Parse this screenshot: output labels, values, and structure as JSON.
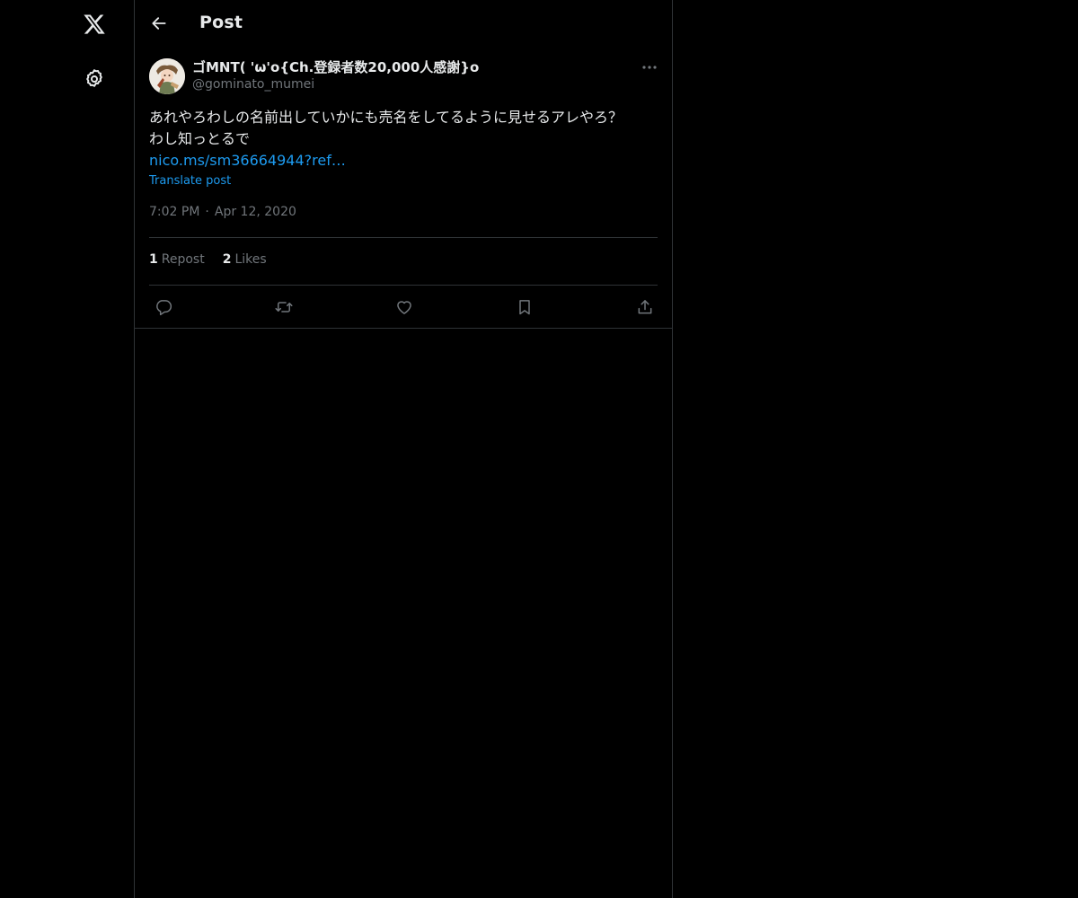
{
  "nav": {
    "logo_icon": "x-logo-icon",
    "settings_icon": "gear-icon"
  },
  "header": {
    "back_icon": "arrow-left-icon",
    "title": "Post"
  },
  "post": {
    "author": {
      "display_name": "ゴMNT( 'ω'o{Ch.登録者数20,000人感謝}o",
      "handle": "@gominato_mumei",
      "avatar_icon": "avatar-image"
    },
    "more_icon": "more-horizontal-icon",
    "text_lines": [
      "あれやろわしの名前出していかにも売名をしてるように見せるアレやろ？",
      "わし知っとるで"
    ],
    "link_text": "nico.ms/sm36664944?ref…",
    "translate_label": "Translate post",
    "time": "7:02 PM",
    "separator": "·",
    "date": "Apr 12, 2020",
    "stats": {
      "reposts_count": "1",
      "reposts_label": "Repost",
      "likes_count": "2",
      "likes_label": "Likes"
    },
    "actions": {
      "reply_icon": "reply-icon",
      "repost_icon": "repost-icon",
      "like_icon": "heart-icon",
      "bookmark_icon": "bookmark-icon",
      "share_icon": "share-icon"
    }
  },
  "colors": {
    "background": "#000000",
    "text_primary": "#e7e9ea",
    "text_secondary": "#71767b",
    "accent": "#1d9bf0",
    "border": "#2f3336"
  }
}
